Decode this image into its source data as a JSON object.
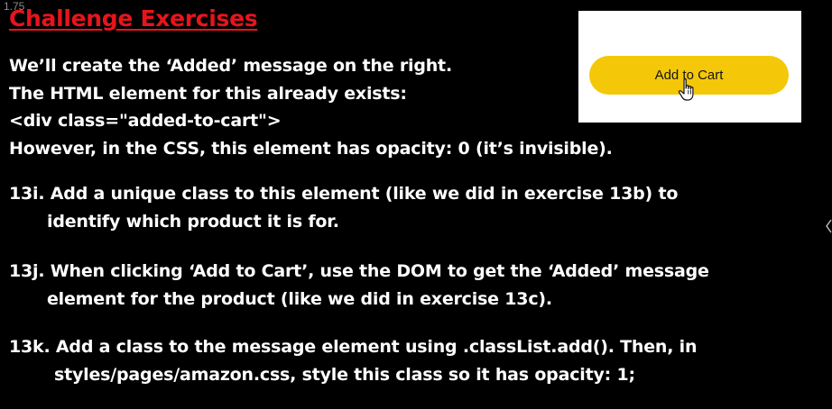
{
  "speed_label": "1.75",
  "title": "Challenge Exercises",
  "intro_lines": [
    "We’ll create the ‘Added’ message on the right.",
    "The HTML element for this already exists:",
    "<div class=\"added-to-cart\">",
    "However, in the CSS, this element has opacity: 0 (it’s invisible)."
  ],
  "exercises": [
    {
      "line1": "13i. Add a unique class to this element (like we did in exercise 13b) to",
      "line2": "identify which product it is for."
    },
    {
      "line1": "13j. When clicking ‘Add to Cart’, use the DOM to get the ‘Added’ message",
      "line2": "element for the product (like we did in exercise 13c)."
    },
    {
      "line1": "13k. Add a class to the message element using .classList.add(). Then, in",
      "line2": "styles/pages/amazon.css, style this class so it has opacity: 1;"
    }
  ],
  "preview": {
    "button_label": "Add to Cart",
    "button_color": "#f4c808"
  },
  "colors": {
    "background": "#000000",
    "title": "#e8141c",
    "text": "#ffffff"
  },
  "icons": [
    "hand-pointer-icon",
    "chevron-left-icon"
  ]
}
